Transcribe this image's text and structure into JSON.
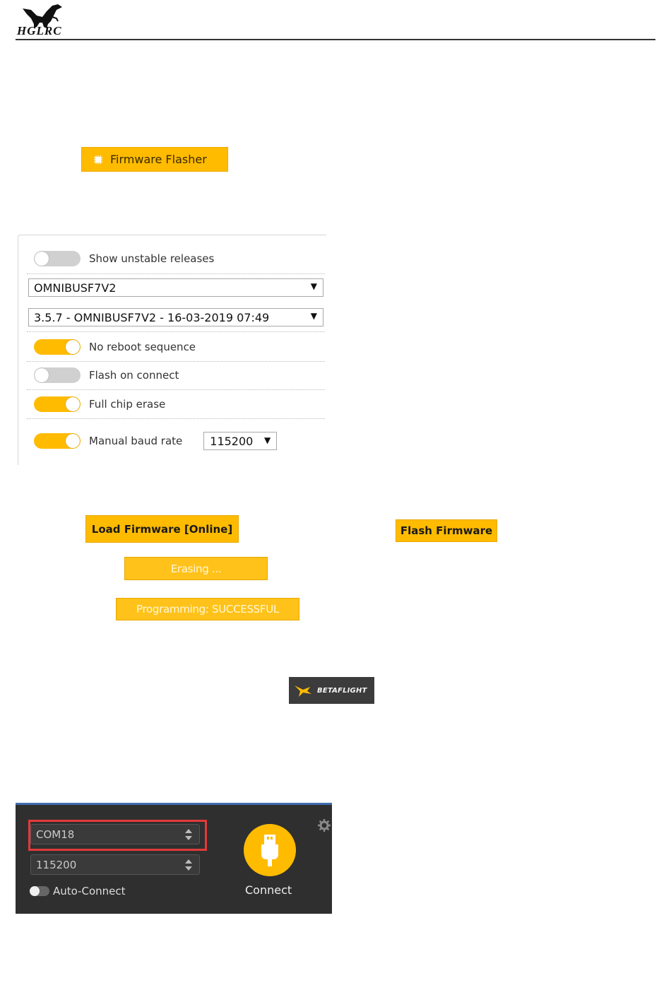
{
  "header": {
    "logo_text": "HGLRC"
  },
  "flasher_tab": {
    "label": "Firmware Flasher",
    "icon": "chip-icon"
  },
  "options": {
    "show_unstable": {
      "label": "Show unstable releases",
      "on": false
    },
    "board_select": {
      "value": "OMNIBUSF7V2"
    },
    "firmware_select": {
      "value": "3.5.7 - OMNIBUSF7V2 - 16-03-2019 07:49"
    },
    "no_reboot": {
      "label": "No reboot sequence",
      "on": true
    },
    "flash_on_connect": {
      "label": "Flash on connect",
      "on": false
    },
    "full_chip_erase": {
      "label": "Full chip erase",
      "on": true
    },
    "manual_baud": {
      "label": "Manual baud rate",
      "on": true,
      "value": "115200"
    }
  },
  "buttons": {
    "load_firmware": "Load Firmware [Online]",
    "flash_firmware": "Flash Firmware",
    "erasing": "Erasing ...",
    "programming": "Programming: SUCCESSFUL"
  },
  "betaflight_logo": {
    "text": "BETAFLIGHT"
  },
  "connect_panel": {
    "port": "COM18",
    "baud": "115200",
    "auto_connect_label": "Auto-Connect",
    "connect_label": "Connect"
  },
  "colors": {
    "accent": "#ffbb00",
    "highlight": "#e23a3a",
    "panel_dark": "#2f2f2f"
  }
}
